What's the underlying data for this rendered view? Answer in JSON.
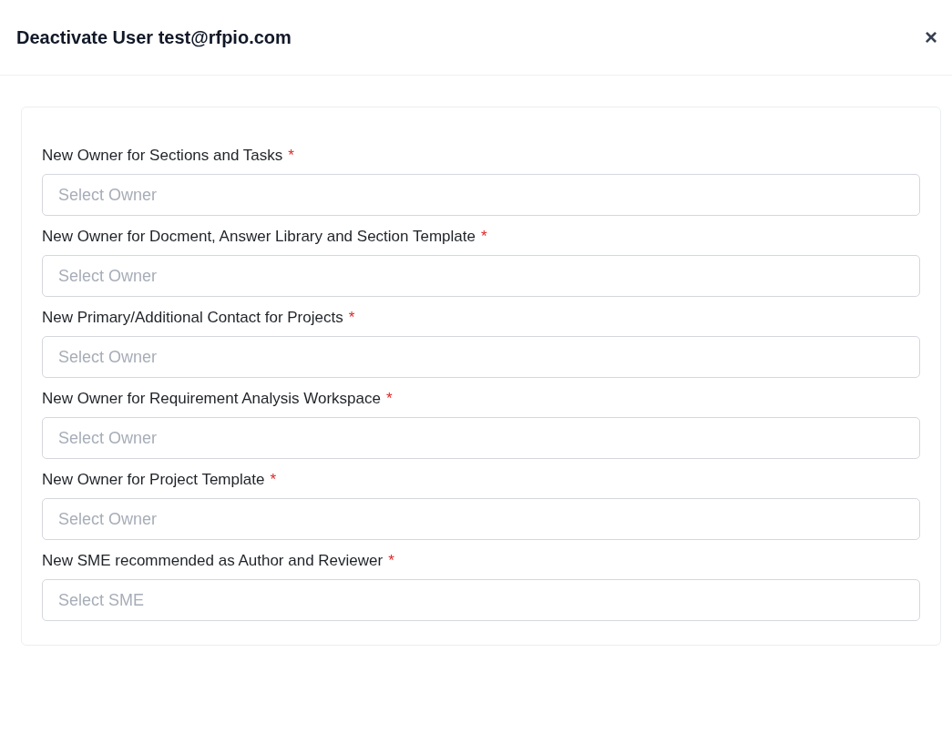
{
  "dialog": {
    "title": "Deactivate User test@rfpio.com",
    "close": "×"
  },
  "fields": [
    {
      "label": "New Owner for Sections and Tasks",
      "required_mark": "*",
      "placeholder": "Select Owner"
    },
    {
      "label": "New Owner for Docment, Answer Library and Section Template",
      "required_mark": "*",
      "placeholder": "Select Owner"
    },
    {
      "label": "New Primary/Additional Contact for Projects",
      "required_mark": "*",
      "placeholder": "Select Owner"
    },
    {
      "label": "New Owner for Requirement Analysis Workspace",
      "required_mark": "*",
      "placeholder": "Select Owner"
    },
    {
      "label": "New Owner for Project Template",
      "required_mark": "*",
      "placeholder": "Select Owner"
    },
    {
      "label": "New SME recommended as Author and Reviewer",
      "required_mark": "*",
      "placeholder": "Select SME"
    }
  ]
}
